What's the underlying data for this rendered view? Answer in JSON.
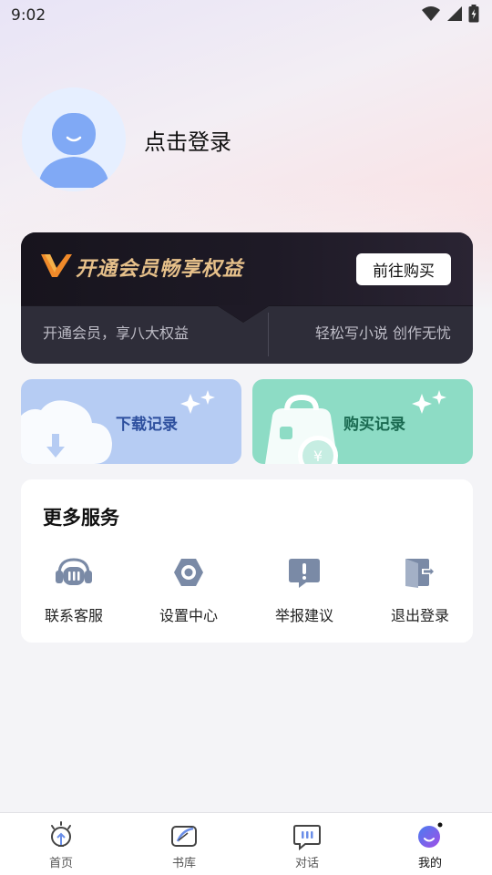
{
  "status_bar": {
    "time": "9:02"
  },
  "profile": {
    "login_text": "点击登录"
  },
  "vip": {
    "title": "开通会员畅享权益",
    "button": "前往购买",
    "sub_left": "开通会员，享八大权益",
    "sub_right": "轻松写小说 创作无忧",
    "accent": "#e6c08a"
  },
  "records": {
    "download": {
      "label": "下载记录",
      "color": "#b6ccf3",
      "text_color": "#2d4f9e"
    },
    "purchase": {
      "label": "购买记录",
      "color": "#8ddcc5",
      "text_color": "#1a6a51"
    }
  },
  "services": {
    "title": "更多服务",
    "items": [
      {
        "label": "联系客服",
        "icon": "headset-icon"
      },
      {
        "label": "设置中心",
        "icon": "gear-icon"
      },
      {
        "label": "举报建议",
        "icon": "report-icon"
      },
      {
        "label": "退出登录",
        "icon": "logout-icon"
      }
    ]
  },
  "tabbar": {
    "items": [
      {
        "label": "首页",
        "icon": "lightbulb-icon"
      },
      {
        "label": "书库",
        "icon": "library-icon"
      },
      {
        "label": "对话",
        "icon": "chat-icon"
      },
      {
        "label": "我的",
        "icon": "profile-icon"
      }
    ],
    "active_index": 3
  }
}
